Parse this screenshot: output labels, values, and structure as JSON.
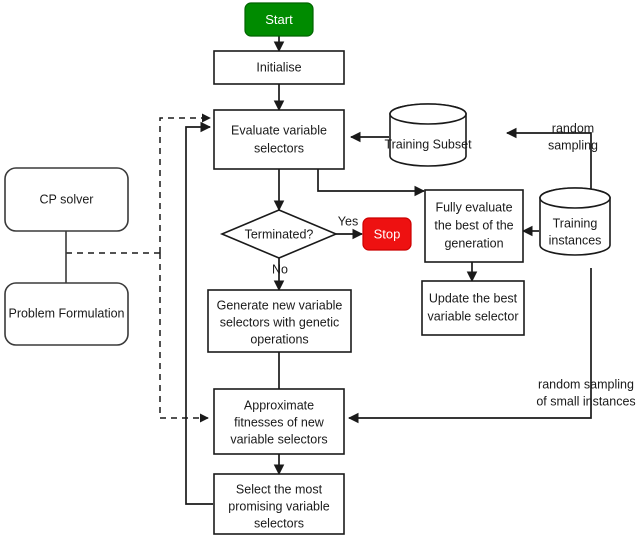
{
  "diagram": {
    "title": "Genetic programming hyper-heuristic flowchart for evolving variable selectors",
    "nodes": {
      "start": {
        "label": "Start",
        "shape": "rounded-terminator",
        "color": "#008b00",
        "text_color": "#ffffff"
      },
      "initialise": {
        "label": "Initialise",
        "shape": "process"
      },
      "evaluate": {
        "line1": "Evaluate variable",
        "line2": "selectors",
        "shape": "process"
      },
      "terminated": {
        "label": "Terminated?",
        "shape": "decision"
      },
      "stop": {
        "label": "Stop",
        "shape": "rounded-terminator",
        "color": "#ee1111",
        "text_color": "#ffffff"
      },
      "generate": {
        "line1": "Generate new variable",
        "line2": "selectors with genetic",
        "line3": "operations",
        "shape": "process"
      },
      "approximate": {
        "line1": "Approximate",
        "line2": "fitnesses of new",
        "line3": "variable selectors",
        "shape": "process"
      },
      "select": {
        "line1": "Select the most",
        "line2": "promising variable",
        "line3": "selectors",
        "shape": "process"
      },
      "fully_evaluate": {
        "line1": "Fully evaluate",
        "line2": "the best of the",
        "line3": "generation",
        "shape": "process"
      },
      "update_best": {
        "line1": "Update the best",
        "line2": "variable selector",
        "shape": "process"
      },
      "training_subset": {
        "label": "Training Subset",
        "shape": "cylinder"
      },
      "training_instances": {
        "line1": "Training",
        "line2": "instances",
        "shape": "cylinder"
      },
      "cp_solver": {
        "label": "CP solver",
        "shape": "rounded-rect"
      },
      "problem_formulation": {
        "label": "Problem Formulation",
        "shape": "rounded-rect"
      }
    },
    "edge_labels": {
      "yes": "Yes",
      "no": "No",
      "random_sampling_line1": "random",
      "random_sampling_line2": "sampling",
      "random_sampling_small_line1": "random sampling",
      "random_sampling_small_line2": "of small instances"
    }
  }
}
